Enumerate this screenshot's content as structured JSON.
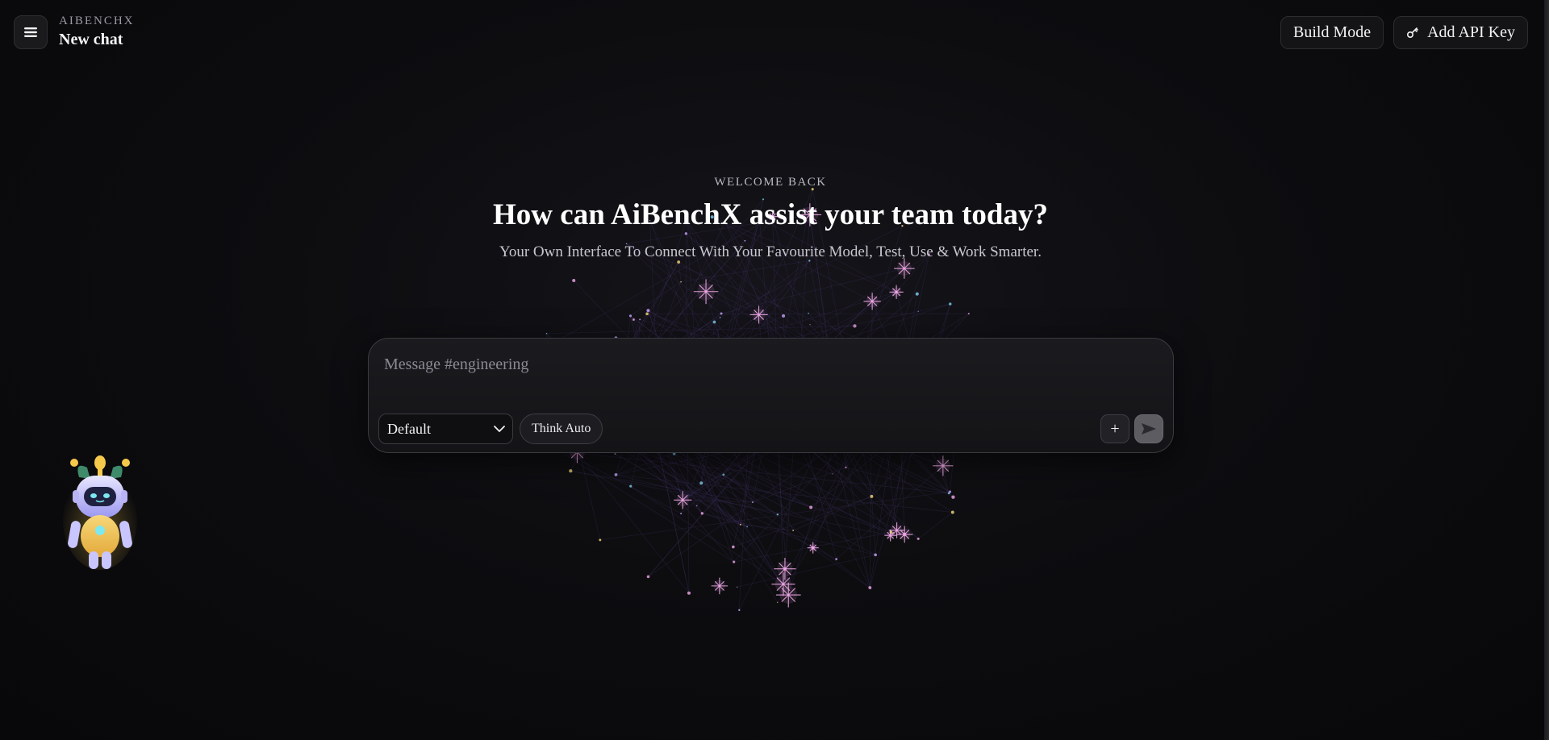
{
  "header": {
    "menu_icon": "hamburger-icon",
    "brand": "AIBENCHX",
    "chat_title": "New chat",
    "build_mode_label": "Build Mode",
    "add_api_key_label": "Add API Key",
    "add_api_key_icon": "key-icon"
  },
  "welcome": {
    "eyebrow": "WELCOME BACK",
    "title": "How can AiBenchX assist your team today?",
    "subtitle": "Your Own Interface To Connect With Your Favourite Model, Test, Use & Work Smarter."
  },
  "composer": {
    "placeholder": "Message #engineering",
    "value": "",
    "model_selected": "Default",
    "think_label": "Think Auto",
    "attach_label": "+",
    "send_icon": "send-icon"
  },
  "mascot": {
    "icon": "robot-mascot-icon"
  },
  "colors": {
    "background": "#0b0b0d",
    "surface": "#1b1b1f",
    "border": "#3a3a40",
    "star_pink": "#f0a8e8",
    "star_gold": "#f5d97a",
    "star_blue": "#7fd0f0"
  }
}
